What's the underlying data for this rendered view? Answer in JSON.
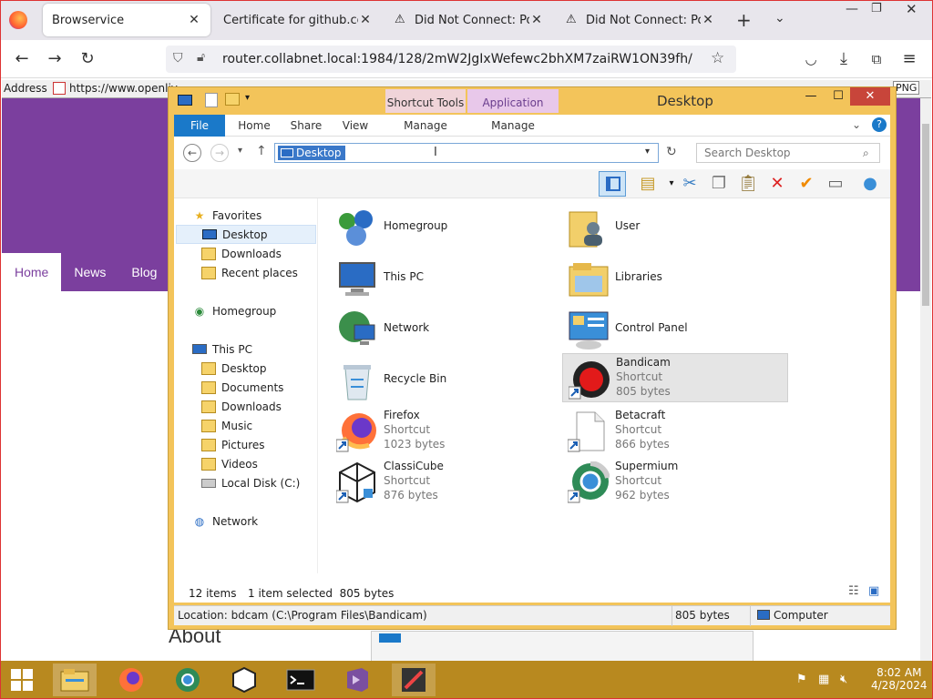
{
  "firefox": {
    "tabs": [
      {
        "label": "Browservice",
        "active": true
      },
      {
        "label": "Certificate for github.com",
        "active": false
      },
      {
        "label": "Did Not Connect: Potent",
        "active": false
      },
      {
        "label": "Did Not Connect: Potent",
        "active": false
      }
    ],
    "url": "router.collabnet.local:1984/128/2mW2JgIxWefewc2bhXM7zaiRW1ON39fh/",
    "colors": {
      "tabstrip": "#e8e6ec",
      "frame": "#dd3333"
    }
  },
  "inner_page": {
    "address_label": "Address",
    "address_value": "https://www.openliv",
    "nav": [
      "Home",
      "News",
      "Blog"
    ],
    "heading": "About",
    "accent": "#7b3f9e",
    "png_badge": "PNG"
  },
  "explorer": {
    "title": "Desktop",
    "context_tabs": [
      "Shortcut Tools",
      "Application Tools"
    ],
    "ribbon_tabs": [
      "File",
      "Home",
      "Share",
      "View",
      "Manage",
      "Manage"
    ],
    "path": "Desktop",
    "search_placeholder": "Search Desktop",
    "nav": {
      "favorites": "Favorites",
      "fav_items": [
        "Desktop",
        "Downloads",
        "Recent places"
      ],
      "homegroup": "Homegroup",
      "this_pc": "This PC",
      "pc_items": [
        "Desktop",
        "Documents",
        "Downloads",
        "Music",
        "Pictures",
        "Videos",
        "Local Disk (C:)"
      ],
      "network": "Network"
    },
    "items": [
      {
        "name": "Homegroup",
        "icon": "homegroup-icon"
      },
      {
        "name": "User",
        "icon": "user-folder-icon"
      },
      {
        "name": "This PC",
        "icon": "computer-icon"
      },
      {
        "name": "Libraries",
        "icon": "libraries-icon"
      },
      {
        "name": "Network",
        "icon": "network-icon"
      },
      {
        "name": "Control Panel",
        "icon": "control-panel-icon"
      },
      {
        "name": "Recycle Bin",
        "icon": "recycle-bin-icon"
      },
      {
        "name": "Bandicam",
        "type": "Shortcut",
        "size": "805 bytes",
        "icon": "bandicam-icon",
        "selected": true
      },
      {
        "name": "Firefox",
        "type": "Shortcut",
        "size": "1023 bytes",
        "icon": "firefox-icon"
      },
      {
        "name": "Betacraft",
        "type": "Shortcut",
        "size": "866 bytes",
        "icon": "file-icon"
      },
      {
        "name": "ClassiCube",
        "type": "Shortcut",
        "size": "876 bytes",
        "icon": "classicube-icon"
      },
      {
        "name": "Supermium",
        "type": "Shortcut",
        "size": "962 bytes",
        "icon": "supermium-icon"
      }
    ],
    "status": {
      "count": "12 items",
      "selected": "1 item selected  805 bytes"
    },
    "details": {
      "location": "Location: bdcam (C:\\Program Files\\Bandicam)",
      "size": "805 bytes",
      "computer": "Computer"
    }
  },
  "taskbar": {
    "time": "8:02 AM",
    "date": "4/28/2024",
    "color": "#b8891f"
  }
}
